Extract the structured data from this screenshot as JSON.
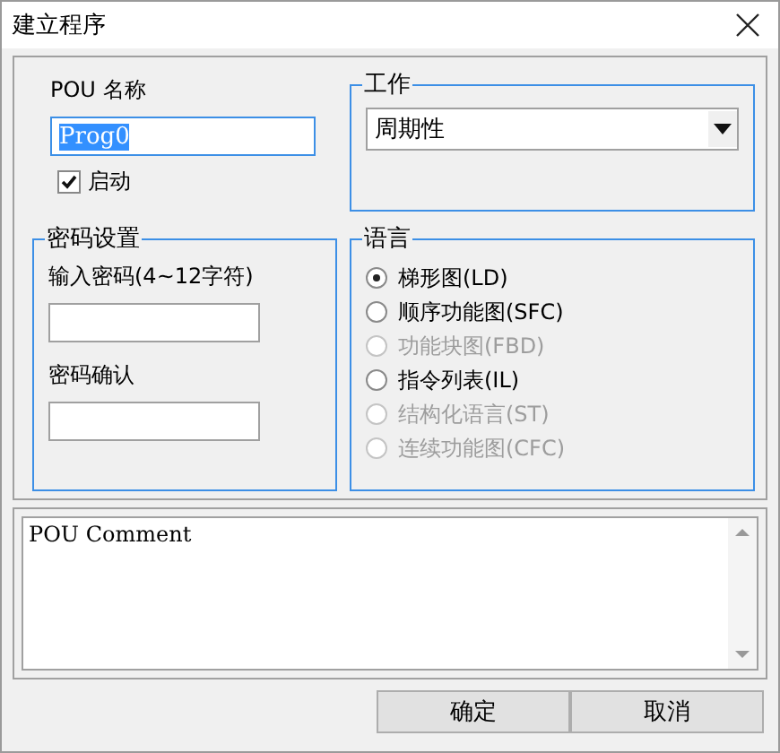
{
  "window": {
    "title": "建立程序"
  },
  "pou_name": {
    "label": "POU 名称",
    "value": "Prog0",
    "text_selected": true
  },
  "start": {
    "label": "启动",
    "checked": true
  },
  "task": {
    "title": "工作",
    "value": "周期性"
  },
  "password": {
    "title": "密码设置",
    "enter_label": "输入密码(4~12字符)",
    "confirm_label": "密码确认"
  },
  "language": {
    "title": "语言",
    "options": [
      {
        "label": "梯形图(LD)",
        "selected": true,
        "disabled": false
      },
      {
        "label": "顺序功能图(SFC)",
        "selected": false,
        "disabled": false
      },
      {
        "label": "功能块图(FBD)",
        "selected": false,
        "disabled": true
      },
      {
        "label": "指令列表(IL)",
        "selected": false,
        "disabled": false
      },
      {
        "label": "结构化语言(ST)",
        "selected": false,
        "disabled": true
      },
      {
        "label": "连续功能图(CFC)",
        "selected": false,
        "disabled": true
      }
    ]
  },
  "comment": {
    "value": "POU Comment"
  },
  "buttons": [
    {
      "label": "确定"
    },
    {
      "label": "取消"
    }
  ]
}
